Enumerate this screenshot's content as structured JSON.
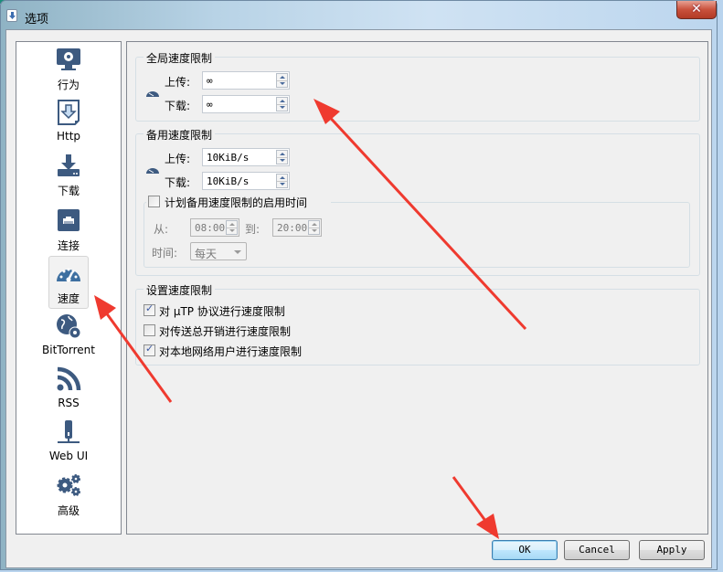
{
  "window": {
    "title": "选项",
    "close_label": "✕"
  },
  "sidebar": {
    "items": [
      {
        "label": "行为",
        "icon": "monitor-gear-icon"
      },
      {
        "label": "Http",
        "icon": "download-document-icon"
      },
      {
        "label": "下载",
        "icon": "download-tray-icon"
      },
      {
        "label": "连接",
        "icon": "ethernet-port-icon"
      },
      {
        "label": "速度",
        "icon": "speedometer-icon",
        "selected": true
      },
      {
        "label": "BitTorrent",
        "icon": "globe-gear-icon"
      },
      {
        "label": "RSS",
        "icon": "rss-icon"
      },
      {
        "label": "Web UI",
        "icon": "web-ui-icon"
      },
      {
        "label": "高级",
        "icon": "gears-icon"
      }
    ]
  },
  "global_limits": {
    "title": "全局速度限制",
    "upload_label": "上传:",
    "upload_value": "∞",
    "download_label": "下载:",
    "download_value": "∞"
  },
  "alt_limits": {
    "title": "备用速度限制",
    "upload_label": "上传:",
    "upload_value": "10KiB/s",
    "download_label": "下载:",
    "download_value": "10KiB/s",
    "schedule": {
      "checkbox_label": "计划备用速度限制的启用时间",
      "checked": false,
      "from_label": "从:",
      "from_value": "08:00",
      "to_label": "到:",
      "to_value": "20:00",
      "when_label": "时间:",
      "when_value": "每天"
    }
  },
  "rate_settings": {
    "title": "设置速度限制",
    "options": [
      {
        "label": "对 µTP 协议进行速度限制",
        "checked": true
      },
      {
        "label": "对传送总开销进行速度限制",
        "checked": false
      },
      {
        "label": "对本地网络用户进行速度限制",
        "checked": true
      }
    ]
  },
  "buttons": {
    "ok": "OK",
    "cancel": "Cancel",
    "apply": "Apply"
  },
  "colors": {
    "icon": "#3d5a80",
    "annotation_arrow": "#ef3a2f"
  }
}
